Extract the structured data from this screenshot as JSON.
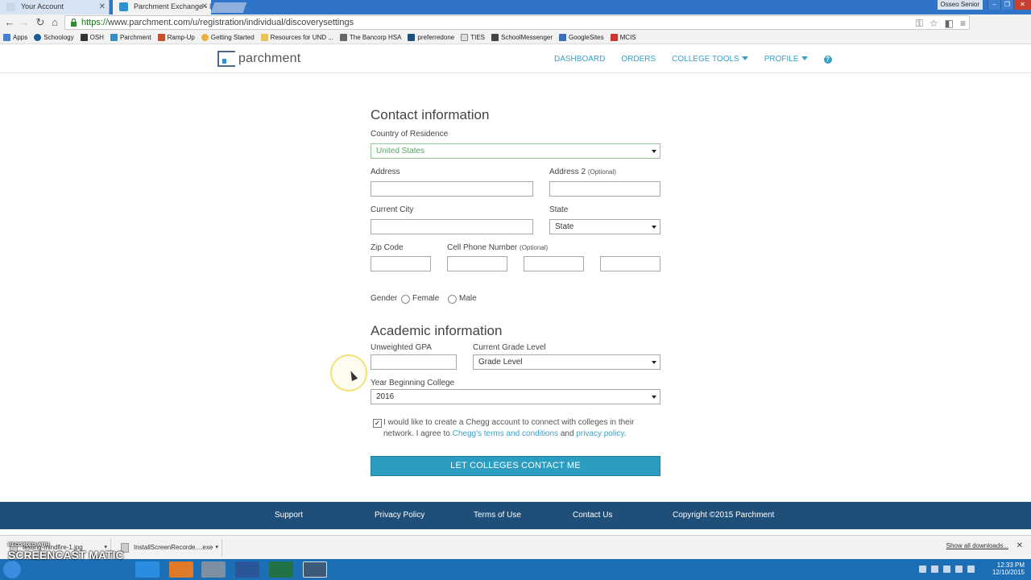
{
  "browser": {
    "tabs": [
      {
        "title": "Your Account",
        "active": false
      },
      {
        "title": "Parchment Exchange - Lea",
        "active": true
      }
    ],
    "user_badge": "Osseo Senior",
    "window_buttons": [
      "–",
      "❐",
      "✕"
    ],
    "url_scheme": "https://",
    "url_host": "www.parchment.com",
    "url_path": "/u/registration/individual/discoverysettings",
    "bookmarks": [
      "Apps",
      "Schoology",
      "OSH",
      "Parchment",
      "Ramp-Up",
      "Getting Started",
      "Resources for UND ...",
      "The Bancorp HSA",
      "preferredone",
      "TIES",
      "SchoolMessenger",
      "GoogleSites",
      "MCIS"
    ]
  },
  "site": {
    "logo_text": "parchment",
    "nav": {
      "dashboard": "DASHBOARD",
      "orders": "ORDERS",
      "college_tools": "COLLEGE TOOLS",
      "profile": "PROFILE",
      "help": "?"
    }
  },
  "contact": {
    "title": "Contact information",
    "country_label": "Country of Residence",
    "country_value": "United States",
    "address_label": "Address",
    "address2_label": "Address 2",
    "optional": "(Optional)",
    "city_label": "Current City",
    "state_label": "State",
    "state_value": "State",
    "zip_label": "Zip Code",
    "phone_label": "Cell Phone Number",
    "gender_label": "Gender",
    "female": "Female",
    "male": "Male"
  },
  "academic": {
    "title": "Academic information",
    "gpa_label": "Unweighted GPA",
    "grade_label": "Current Grade Level",
    "grade_value": "Grade Level",
    "year_label": "Year Beginning College",
    "year_value": "2016"
  },
  "consent": {
    "checked": true,
    "text_1": "I would like to create a Chegg account to connect with colleges in their network. I agree to ",
    "terms_link": "Chegg's terms and conditions",
    "and": " and ",
    "privacy_link": "privacy policy",
    "period": "."
  },
  "submit_label": "LET COLLEGES CONTACT ME",
  "footer": {
    "support": "Support",
    "privacy": "Privacy Policy",
    "terms": "Terms of Use",
    "contact": "Contact Us",
    "copyright": "Copyright ©2015 Parchment"
  },
  "downloads": {
    "items": [
      "testing-mindfire-1.jpg",
      "InstallScreenRecorde....exe"
    ],
    "show_all": "Show all downloads...",
    "close": "✕"
  },
  "taskbar": {
    "time": "12:33 PM",
    "date": "12/10/2015"
  },
  "watermark": {
    "small": "RECORDED WITH",
    "big": "SCREENCAST MATIC"
  },
  "colors": {
    "accent": "#2a9dc0",
    "nav_link": "#3aa0c8",
    "footer_bg": "#1f4f79",
    "country_green": "#5aa469",
    "taskbar": "#1d6fb5"
  }
}
